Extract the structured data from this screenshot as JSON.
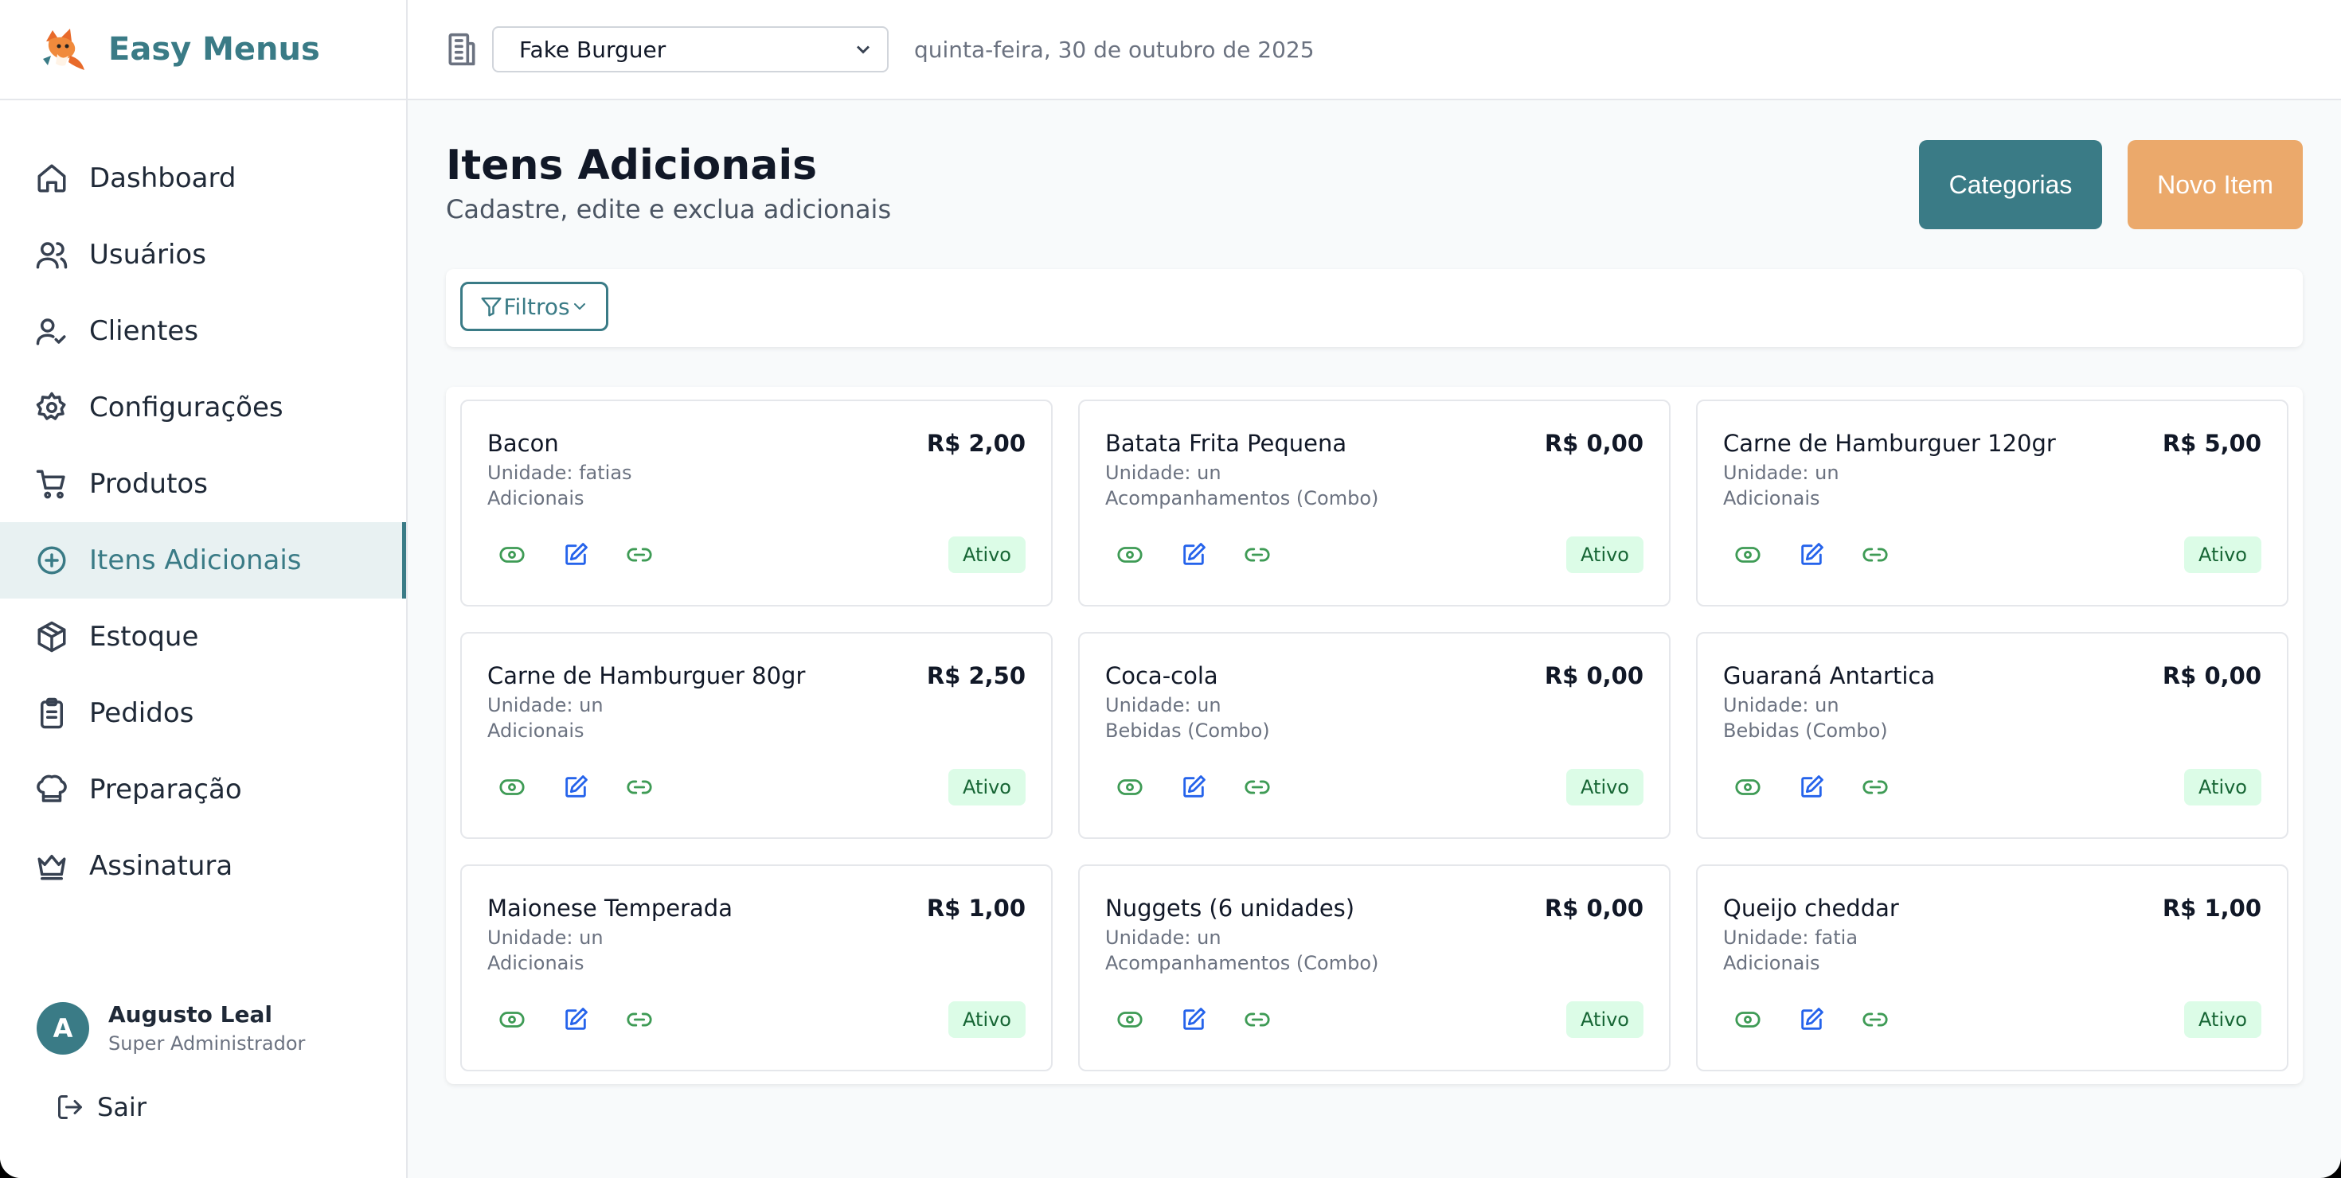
{
  "brand": {
    "name": "Easy Menus"
  },
  "topbar": {
    "store": "Fake Burguer",
    "date": "quinta-feira, 30 de outubro de 2025"
  },
  "sidebar": {
    "items": [
      {
        "label": "Dashboard",
        "icon": "home-icon"
      },
      {
        "label": "Usuários",
        "icon": "users-icon"
      },
      {
        "label": "Clientes",
        "icon": "user-check-icon"
      },
      {
        "label": "Configurações",
        "icon": "gear-icon"
      },
      {
        "label": "Produtos",
        "icon": "cart-icon"
      },
      {
        "label": "Itens Adicionais",
        "icon": "plus-circle-icon"
      },
      {
        "label": "Estoque",
        "icon": "box-icon"
      },
      {
        "label": "Pedidos",
        "icon": "clipboard-icon"
      },
      {
        "label": "Preparação",
        "icon": "chef-hat-icon"
      },
      {
        "label": "Assinatura",
        "icon": "crown-icon"
      }
    ],
    "user": {
      "initial": "A",
      "name": "Augusto Leal",
      "role": "Super Administrador"
    },
    "logout": "Sair"
  },
  "page": {
    "title": "Itens Adicionais",
    "subtitle": "Cadastre, edite e exclua adicionais",
    "categories_button": "Categorias",
    "new_button": "Novo Item",
    "filters_button": "Filtros"
  },
  "items": [
    {
      "name": "Bacon",
      "price": "R$ 2,00",
      "unit": "Unidade: fatias",
      "category": "Adicionais",
      "status": "Ativo"
    },
    {
      "name": "Batata Frita Pequena",
      "price": "R$ 0,00",
      "unit": "Unidade: un",
      "category": "Acompanhamentos (Combo)",
      "status": "Ativo"
    },
    {
      "name": "Carne de Hamburguer 120gr",
      "price": "R$ 5,00",
      "unit": "Unidade: un",
      "category": "Adicionais",
      "status": "Ativo"
    },
    {
      "name": "Carne de Hamburguer 80gr",
      "price": "R$ 2,50",
      "unit": "Unidade: un",
      "category": "Adicionais",
      "status": "Ativo"
    },
    {
      "name": "Coca-cola",
      "price": "R$ 0,00",
      "unit": "Unidade: un",
      "category": "Bebidas (Combo)",
      "status": "Ativo"
    },
    {
      "name": "Guaraná Antartica",
      "price": "R$ 0,00",
      "unit": "Unidade: un",
      "category": "Bebidas (Combo)",
      "status": "Ativo"
    },
    {
      "name": "Maionese Temperada",
      "price": "R$ 1,00",
      "unit": "Unidade: un",
      "category": "Adicionais",
      "status": "Ativo"
    },
    {
      "name": "Nuggets (6 unidades)",
      "price": "R$ 0,00",
      "unit": "Unidade: un",
      "category": "Acompanhamentos (Combo)",
      "status": "Ativo"
    },
    {
      "name": "Queijo cheddar",
      "price": "R$ 1,00",
      "unit": "Unidade: fatia",
      "category": "Adicionais",
      "status": "Ativo"
    }
  ]
}
